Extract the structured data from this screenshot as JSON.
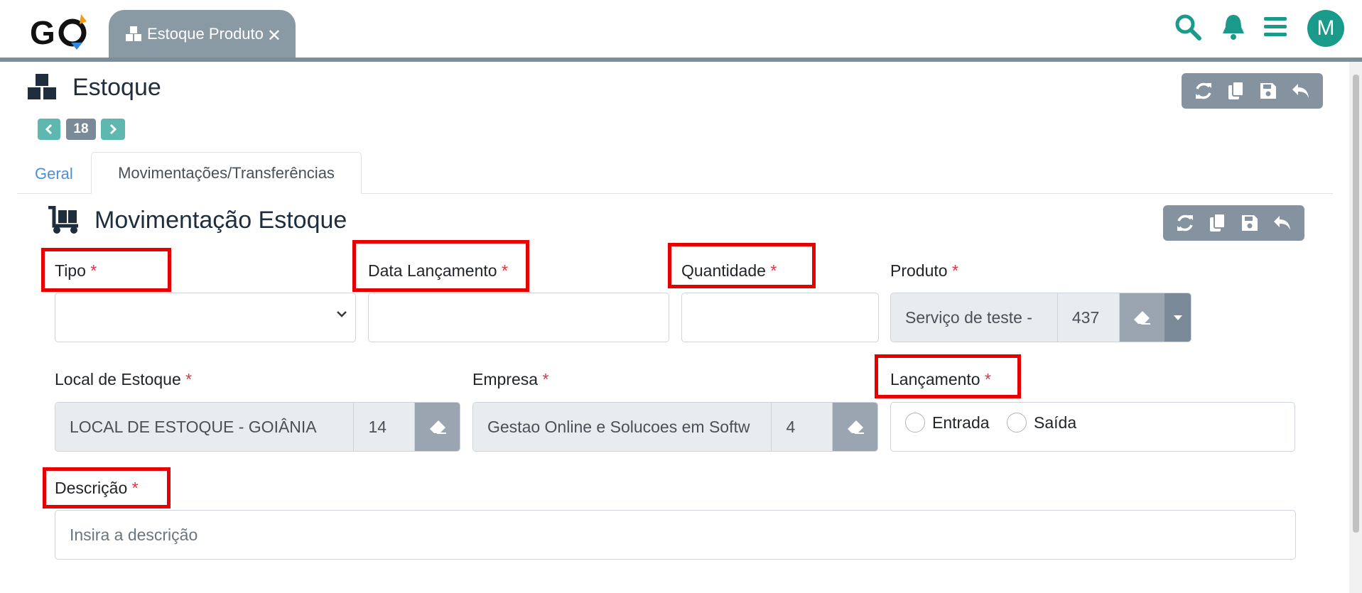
{
  "app": {
    "open_tab": "Estoque Produto",
    "avatar_initial": "M",
    "accent_color": "#1a9a8b"
  },
  "page": {
    "title": "Estoque",
    "record_number": "18"
  },
  "tabs": [
    {
      "label": "Geral",
      "active": false
    },
    {
      "label": "Movimentações/Transferências",
      "active": true
    }
  ],
  "section": {
    "title": "Movimentação Estoque"
  },
  "form": {
    "tipo": {
      "label": "Tipo",
      "value": ""
    },
    "data_lancamento": {
      "label": "Data Lançamento",
      "value": ""
    },
    "quantidade": {
      "label": "Quantidade",
      "value": ""
    },
    "produto": {
      "label": "Produto",
      "text": "Serviço de teste -",
      "id": "437"
    },
    "local_estoque": {
      "label": "Local de Estoque",
      "text": "LOCAL DE ESTOQUE - GOIÂNIA",
      "id": "14"
    },
    "empresa": {
      "label": "Empresa",
      "text": "Gestao Online e Solucoes em Softw",
      "id": "4"
    },
    "lancamento": {
      "label": "Lançamento",
      "options": [
        "Entrada",
        "Saída"
      ]
    },
    "descricao": {
      "label": "Descrição",
      "placeholder": "Insira a descrição"
    },
    "required_mark": "*"
  }
}
